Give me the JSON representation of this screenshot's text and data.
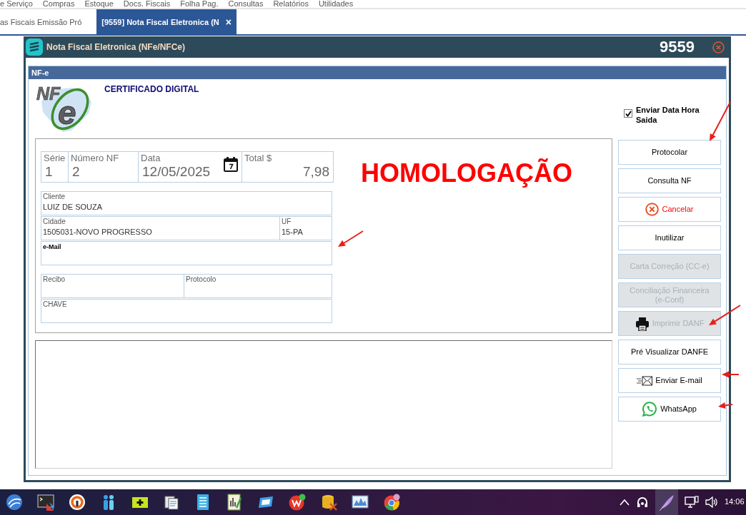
{
  "menu_bar": {
    "items": [
      "e Serviço",
      "Compras",
      "Estoque",
      "Docs. Fiscais",
      "Folha Pag.",
      "Consultas",
      "Relatórios",
      "Utilidades"
    ]
  },
  "tabs": [
    {
      "label": "as Fiscais Emissão Pró",
      "selected": false
    },
    {
      "label": "[9559] Nota Fiscal Eletronica (N",
      "selected": true,
      "close": "×"
    }
  ],
  "window": {
    "title": "Nota Fiscal Eletronica (NFe/NFCe)",
    "number": "9559"
  },
  "panel": {
    "title": "NF-e",
    "logo": {
      "prefix": "NF",
      "letter": "e"
    },
    "certificate": "CERTIFICADO DIGITAL",
    "environment": "HOMOLOGAÇÃO"
  },
  "send_datetime": {
    "label": "Enviar Data Hora Saida",
    "checked": true
  },
  "invoice_header": [
    {
      "label": "Série",
      "value": "1",
      "kind": "text"
    },
    {
      "label": "Número NF",
      "value": "2",
      "kind": "text"
    },
    {
      "label": "Data",
      "value": "12/05/2025",
      "kind": "date"
    },
    {
      "label": "Total $",
      "value": "7,98",
      "kind": "amount"
    }
  ],
  "customer_rows": [
    [
      {
        "label": "Cliente",
        "value": "LUIZ DE SOUZA",
        "emphasized": false,
        "arrow": false
      }
    ],
    [
      {
        "label": "Cidade",
        "value": "1505031-NOVO PROGRESSO",
        "emphasized": false,
        "arrow": false
      },
      {
        "label": "UF",
        "value": "15-PA",
        "emphasized": false,
        "arrow": false
      }
    ],
    [
      {
        "label": "e-Mail",
        "emphasized": true,
        "arrow": true
      }
    ]
  ],
  "authorization_rows": [
    [
      {
        "label": "Recibo",
        "emphasized": false,
        "arrow": false
      },
      {
        "label": "Protocolo",
        "emphasized": false,
        "arrow": false
      }
    ],
    [
      {
        "label": "CHAVE",
        "emphasized": false,
        "arrow": false
      }
    ]
  ],
  "buttons": [
    {
      "label": "Protocolar",
      "kind": "plain",
      "disabled": false,
      "arrow": true
    },
    {
      "label": "Consulta NF",
      "kind": "plain",
      "disabled": false,
      "arrow": false
    },
    {
      "label": "Cancelar",
      "kind": "cancel",
      "disabled": false,
      "arrow": false
    },
    {
      "label": "Inutilizar",
      "kind": "plain",
      "disabled": false,
      "arrow": false
    },
    {
      "label": "Carta Correção (CC-e)",
      "kind": "plain",
      "disabled": true,
      "arrow": false
    },
    {
      "label": "Conciliação Financeira (e-Conf)",
      "kind": "plain",
      "disabled": true,
      "arrow": false
    },
    {
      "label": "Imprimir DANF",
      "kind": "print",
      "disabled": true,
      "arrow": true
    },
    {
      "label": "Pré Visualizar DANFE",
      "kind": "plain",
      "disabled": false,
      "arrow": false
    },
    {
      "label": "Enviar E-mail",
      "kind": "email",
      "disabled": false,
      "arrow": true
    },
    {
      "label": "WhatsApp",
      "kind": "whatsapp",
      "disabled": false,
      "arrow": true
    }
  ],
  "taskbar": {
    "clock": "14:06"
  }
}
